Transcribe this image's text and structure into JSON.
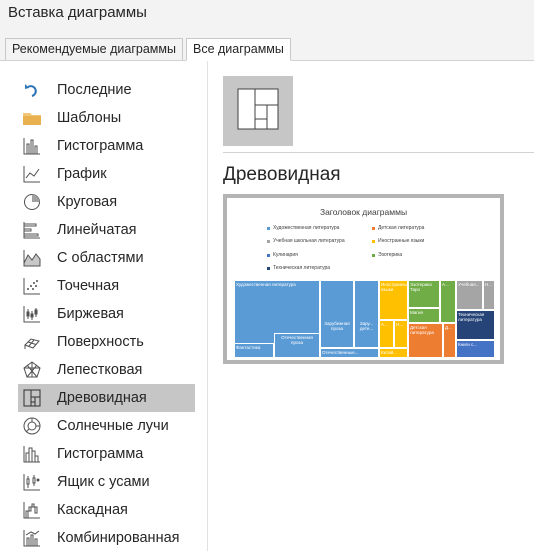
{
  "window": {
    "title": "Вставка диаграммы"
  },
  "tabs": [
    {
      "label": "Рекомендуемые диаграммы",
      "active": false
    },
    {
      "label": "Все диаграммы",
      "active": true
    }
  ],
  "sidebar": {
    "selected_index": 12,
    "items": [
      {
        "label": "Последние",
        "icon": "undo-arrow-icon"
      },
      {
        "label": "Шаблоны",
        "icon": "folder-icon"
      },
      {
        "label": "Гистограмма",
        "icon": "column-chart-icon"
      },
      {
        "label": "График",
        "icon": "line-chart-icon"
      },
      {
        "label": "Круговая",
        "icon": "pie-chart-icon"
      },
      {
        "label": "Линейчатая",
        "icon": "bar-chart-icon"
      },
      {
        "label": "С областями",
        "icon": "area-chart-icon"
      },
      {
        "label": "Точечная",
        "icon": "scatter-chart-icon"
      },
      {
        "label": "Биржевая",
        "icon": "stock-chart-icon"
      },
      {
        "label": "Поверхность",
        "icon": "surface-chart-icon"
      },
      {
        "label": "Лепестковая",
        "icon": "radar-chart-icon"
      },
      {
        "label": "Древовидная",
        "icon": "treemap-chart-icon"
      },
      {
        "label": "Солнечные лучи",
        "icon": "sunburst-chart-icon"
      },
      {
        "label": "Гистограмма",
        "icon": "histogram-chart-icon"
      },
      {
        "label": "Ящик с усами",
        "icon": "box-whisker-chart-icon"
      },
      {
        "label": "Каскадная",
        "icon": "waterfall-chart-icon"
      },
      {
        "label": "Комбинированная",
        "icon": "combo-chart-icon"
      }
    ]
  },
  "main": {
    "section_title": "Древовидная",
    "subtype_icon": "treemap-subtype-icon",
    "preview": {
      "title": "Заголовок диаграммы",
      "legend": [
        {
          "label": "Художественная литература",
          "color": "#5b9bd5"
        },
        {
          "label": "Детская литература",
          "color": "#ed7d31"
        },
        {
          "label": "Учебная школьная литература",
          "color": "#a5a5a5"
        },
        {
          "label": "Иностранные языки",
          "color": "#ffc000"
        },
        {
          "label": "Кулинария",
          "color": "#4472c4"
        },
        {
          "label": "Эзотерика",
          "color": "#70ad47"
        },
        {
          "label": "Техническая литература",
          "color": "#264478"
        }
      ],
      "tiles": [
        {
          "label": "Художественная литература",
          "color": "#5b9bd5"
        },
        {
          "label": "Фантастика",
          "color": "#5b9bd5"
        },
        {
          "label": "Отечественная проза",
          "color": "#5b9bd5"
        },
        {
          "label": "Зарубежная проза",
          "color": "#5b9bd5"
        },
        {
          "label": "Зару... дете...",
          "color": "#5b9bd5"
        },
        {
          "label": "Отечественные...",
          "color": "#5b9bd5"
        },
        {
          "label": "Иностранные языки",
          "color": "#ffc000"
        },
        {
          "label": "А...",
          "color": "#ffc000"
        },
        {
          "label": "Н...",
          "color": "#ffc000"
        },
        {
          "label": "Китай...",
          "color": "#ffc000"
        },
        {
          "label": "Эзотерика Таро",
          "color": "#70ad47"
        },
        {
          "label": "Магия",
          "color": "#70ad47"
        },
        {
          "label": "А...",
          "color": "#70ad47"
        },
        {
          "label": "Детская литература",
          "color": "#ed7d31"
        },
        {
          "label": "Д...",
          "color": "#ed7d31"
        },
        {
          "label": "Учебная...",
          "color": "#a5a5a5"
        },
        {
          "label": "Н...",
          "color": "#a5a5a5"
        },
        {
          "label": "Техническая литература",
          "color": "#264478"
        },
        {
          "label": "Книги с...",
          "color": "#4472c4"
        }
      ]
    }
  }
}
